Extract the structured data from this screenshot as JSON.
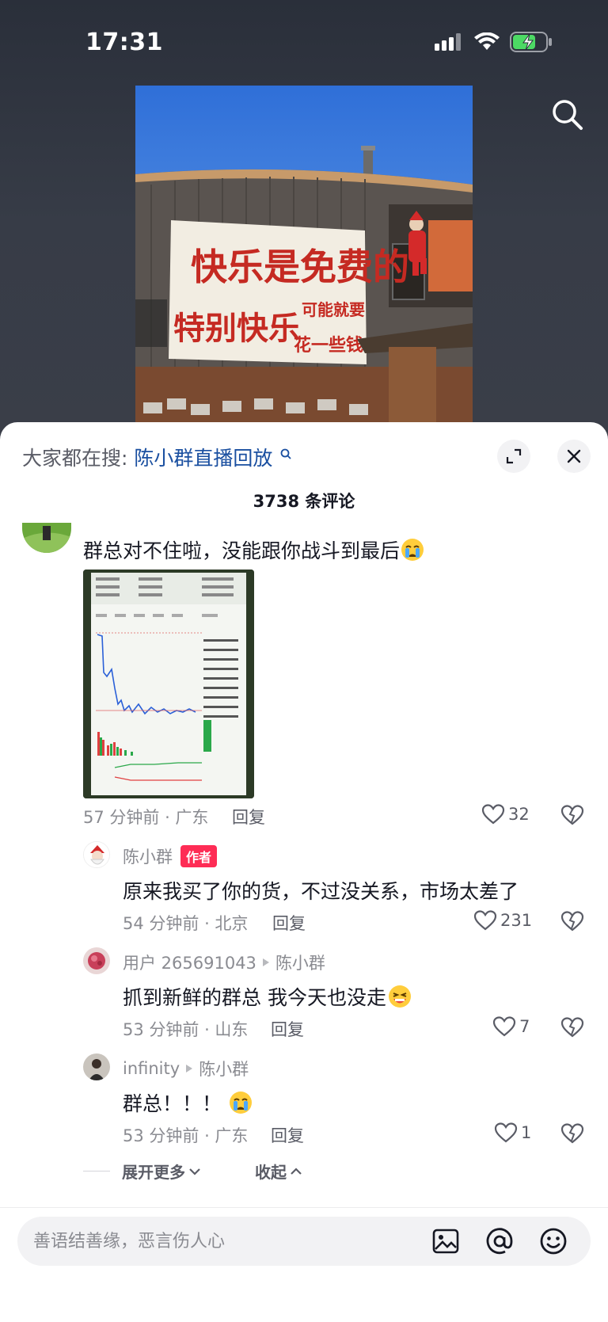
{
  "status": {
    "time": "17:31"
  },
  "video": {
    "banner_line1": "快乐是免费的",
    "banner_line2": "特别快乐",
    "banner_line2b": "可能就要",
    "banner_line2c": "花一些钱"
  },
  "sheet": {
    "hot_search_prefix": "大家都在搜:",
    "hot_search_term": "陈小群直播回放",
    "comment_count": "3738 条评论"
  },
  "comments": [
    {
      "text": "群总对不住啦，没能跟你战斗到最后",
      "meta": "57 分钟前 · 广东",
      "reply": "回复",
      "likes": "32"
    }
  ],
  "replies": [
    {
      "user": "陈小群",
      "badge": "作者",
      "text": "原来我买了你的货，不过没关系，市场太差了",
      "meta": "54 分钟前 · 北京",
      "reply": "回复",
      "likes": "231"
    },
    {
      "user": "用户 265691043",
      "target": "陈小群",
      "text": "抓到新鲜的群总 我今天也没走",
      "meta": "53 分钟前 · 山东",
      "reply": "回复",
      "likes": "7"
    },
    {
      "user": "infinity",
      "target": "陈小群",
      "text": "群总！！！",
      "meta": "53 分钟前 · 广东",
      "reply": "回复",
      "likes": "1"
    }
  ],
  "expand": {
    "more": "展开更多",
    "collapse": "收起"
  },
  "input": {
    "placeholder": "善语结善缘，恶言伤人心"
  },
  "colors": {
    "accent": "#fe2c55",
    "link": "#1a4fa0",
    "text": "#161823",
    "muted": "#8a8b91",
    "battery": "#4cd964"
  },
  "icons": [
    "signal-icon",
    "wifi-icon",
    "battery-icon",
    "search-icon",
    "expand-icon",
    "close-icon",
    "heart-icon",
    "dislike-icon",
    "image-icon",
    "at-icon",
    "emoji-icon",
    "chevron-down-icon",
    "chevron-up-icon"
  ]
}
